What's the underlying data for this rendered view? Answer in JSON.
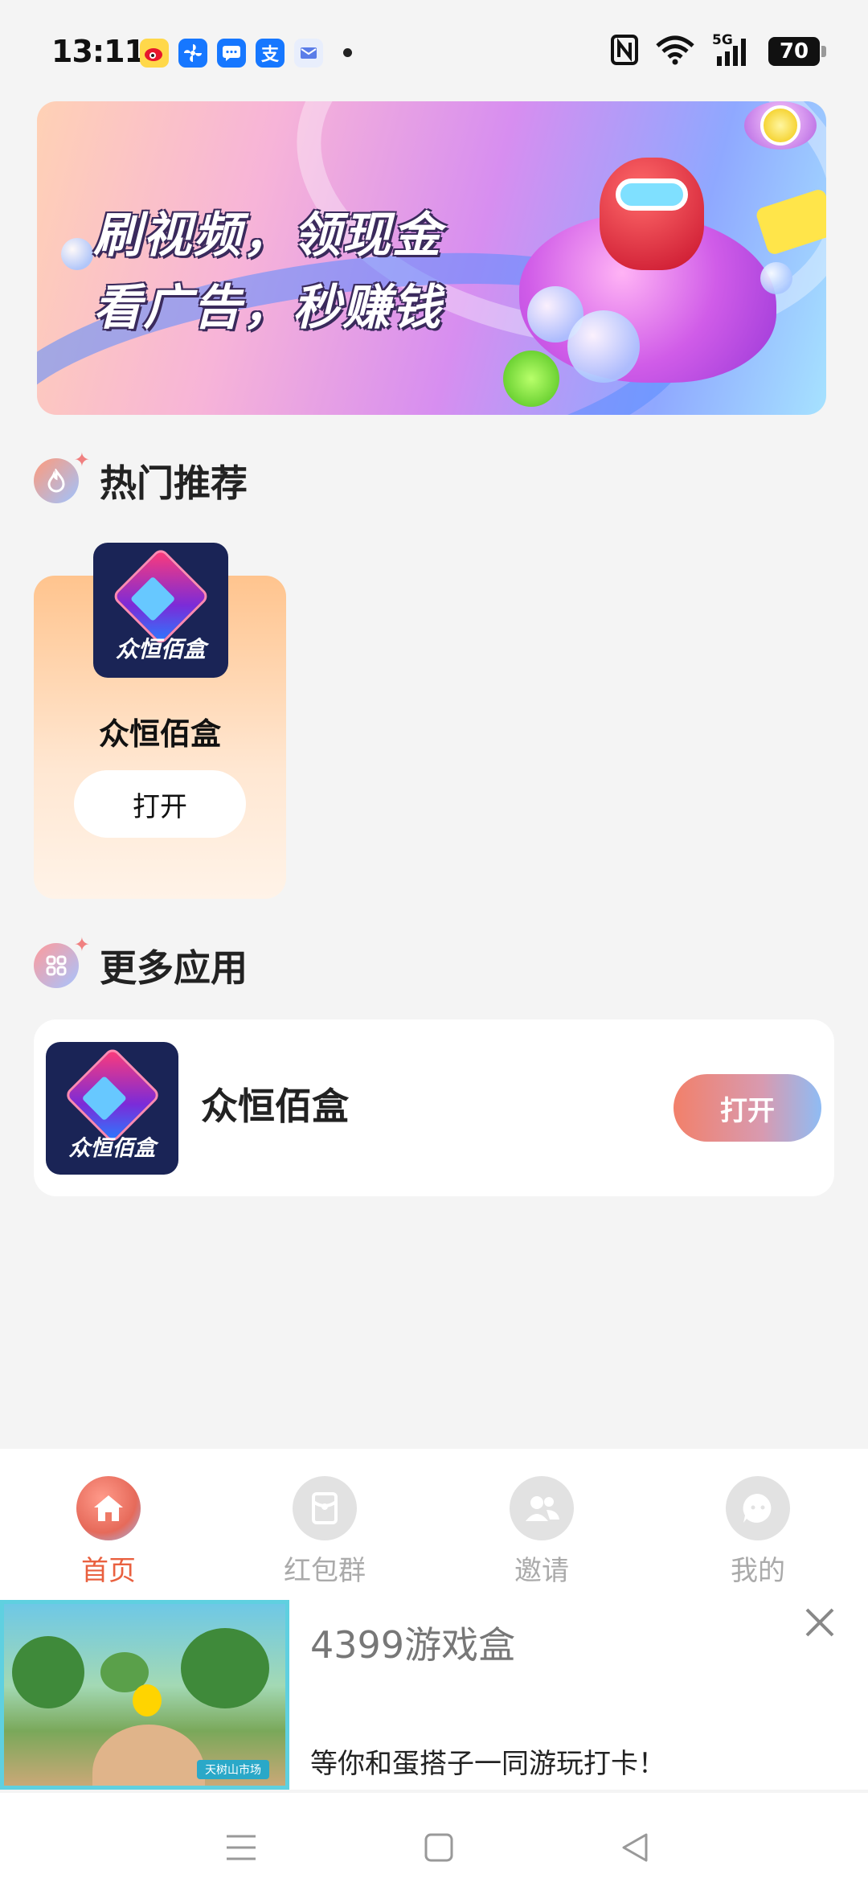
{
  "status_bar": {
    "time": "13:11",
    "notification_icons": [
      "weibo-icon",
      "fan-icon",
      "message-icon",
      "alipay-icon",
      "email-icon"
    ],
    "alipay_glyph": "支",
    "network": "5G",
    "battery": "70"
  },
  "banner": {
    "line1": "刷视频，领现金",
    "line2": "看广告，秒赚钱"
  },
  "hot_section": {
    "title": "热门推荐",
    "items": [
      {
        "icon_text": "众恒佰盒",
        "name": "众恒佰盒",
        "button": "打开"
      }
    ]
  },
  "more_section": {
    "title": "更多应用",
    "items": [
      {
        "icon_text": "众恒佰盒",
        "name": "众恒佰盒",
        "button": "打开"
      }
    ]
  },
  "bottom_nav": {
    "items": [
      {
        "label": "首页",
        "icon": "home-icon",
        "active": true
      },
      {
        "label": "红包群",
        "icon": "red-packet-icon",
        "active": false
      },
      {
        "label": "邀请",
        "icon": "invite-icon",
        "active": false
      },
      {
        "label": "我的",
        "icon": "profile-icon",
        "active": false
      }
    ]
  },
  "ad": {
    "title": "4399游戏盒",
    "description": "等你和蛋搭子一同游玩打卡！",
    "thumb_tag": "天树山市场"
  },
  "colors": {
    "accent": "#e9603f",
    "background": "#f4f4f4"
  }
}
